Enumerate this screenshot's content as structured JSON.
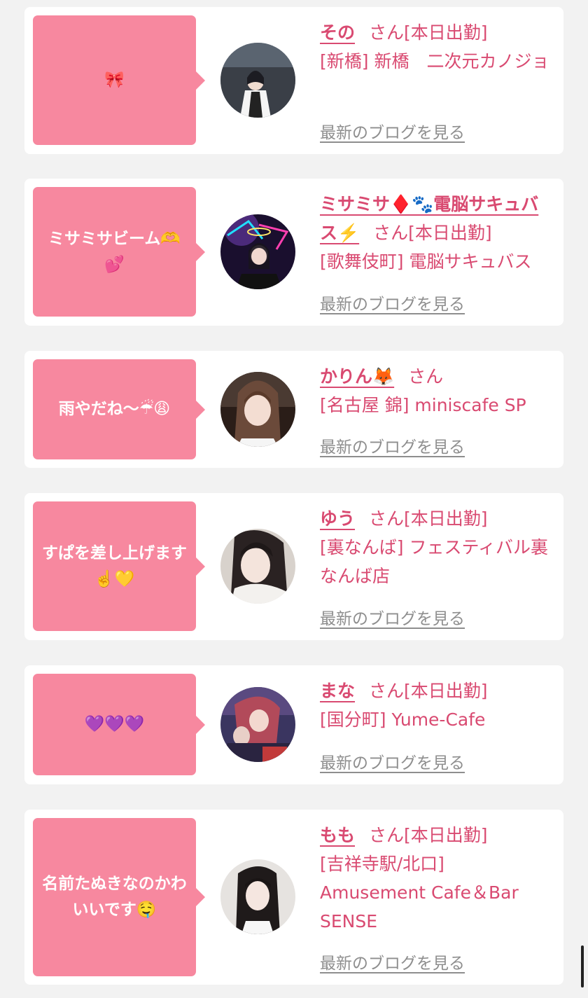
{
  "cards": [
    {
      "bubble": "🎀",
      "name": "その",
      "suffix": "さん",
      "status": "[本日出勤]",
      "shop": "[新橋] 新橋　二次元カノジョ",
      "blog": "最新のブログを見る",
      "avatar_colors": [
        "#7f8a95",
        "#2d2f36"
      ]
    },
    {
      "bubble": "ミサミサビーム🫶💕",
      "name": "ミサミサ♦️🐾電脳サキュバス⚡️",
      "suffix": "さん",
      "status": "[本日出勤]",
      "shop": "[歌舞伎町] 電脳サキュバス",
      "blog": "最新のブログを見る",
      "avatar_colors": [
        "#4b2a7a",
        "#1a0f2e"
      ]
    },
    {
      "bubble": "雨やだね〜☔😩",
      "name": "かりん🦊",
      "suffix": "さん",
      "status": "",
      "shop": "[名古屋 錦] miniscafe SP",
      "blog": "最新のブログを見る",
      "avatar_colors": [
        "#6b4a3a",
        "#2a1d18"
      ]
    },
    {
      "bubble": "すぱを差し上げます☝️💛",
      "name": "ゆう",
      "suffix": "さん",
      "status": "[本日出勤]",
      "shop": "[裏なんば] フェスティバル裏なんば店",
      "blog": "最新のブログを見る",
      "avatar_colors": [
        "#d8d2cc",
        "#3a3030"
      ]
    },
    {
      "bubble": "💜💜💜",
      "name": "まな",
      "suffix": "さん",
      "status": "[本日出勤]",
      "shop": "[国分町] Yume-Cafe",
      "blog": "最新のブログを見る",
      "avatar_colors": [
        "#b24a5a",
        "#3a3560"
      ]
    },
    {
      "bubble": "名前たぬきなのかわいいです🤤",
      "name": "もも",
      "suffix": "さん",
      "status": "[本日出勤]",
      "shop": "[吉祥寺駅/北口] Amusement Cafe＆Bar SENSE",
      "blog": "最新のブログを見る",
      "avatar_colors": [
        "#e6e3e0",
        "#2a2626"
      ]
    }
  ]
}
